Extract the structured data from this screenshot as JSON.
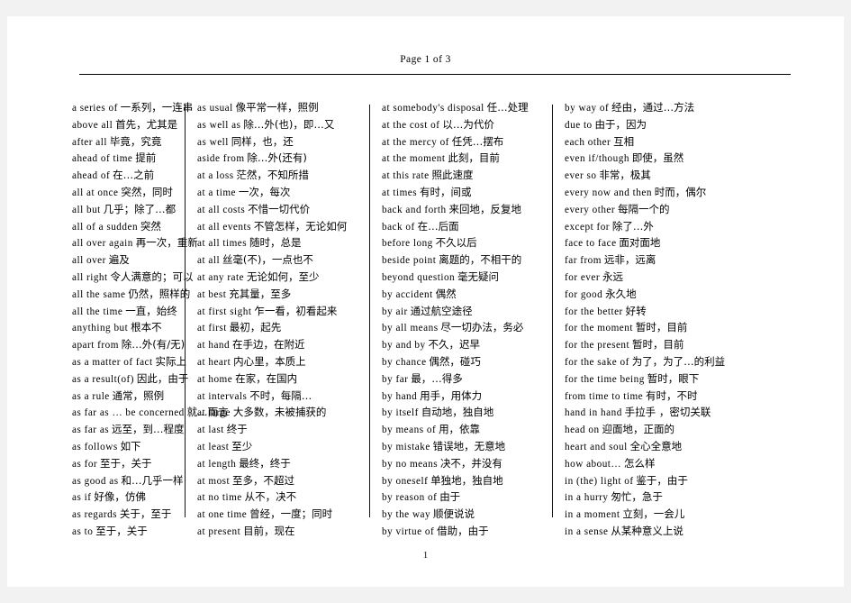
{
  "header": {
    "page_indicator": "Page 1 of 3"
  },
  "footer": {
    "page_number": "1"
  },
  "colors": {
    "page_background": "#ffffff",
    "canvas_background": "#f2f2f2",
    "text": "#000000",
    "rule": "#000000"
  },
  "columns": [
    {
      "entries": [
        {
          "en": "a series of",
          "zh": "一系列，一连串"
        },
        {
          "en": "above all",
          "zh": "首先，尤其是"
        },
        {
          "en": "after all",
          "zh": "毕竟，究竟"
        },
        {
          "en": "ahead of time",
          "zh": "提前"
        },
        {
          "en": "ahead of",
          "zh": "在…之前"
        },
        {
          "en": "all at once",
          "zh": "突然，同时"
        },
        {
          "en": "all but",
          "zh": "几乎；除了…都"
        },
        {
          "en": "all of a sudden",
          "zh": "突然"
        },
        {
          "en": "all over again",
          "zh": "再一次，重新"
        },
        {
          "en": "all over",
          "zh": "遍及"
        },
        {
          "en": "all right",
          "zh": "令人满意的；可以"
        },
        {
          "en": "all the same",
          "zh": "仍然，照样的"
        },
        {
          "en": "all the time",
          "zh": "一直，始终"
        },
        {
          "en": "anything but",
          "zh": "根本不"
        },
        {
          "en": "apart from",
          "zh": "除…外(有/无)"
        },
        {
          "en": "as a matter of fact",
          "zh": "实际上"
        },
        {
          "en": "as a result(of)",
          "zh": "因此，由于"
        },
        {
          "en": "as a rule",
          "zh": "通常，照例"
        },
        {
          "en": "as far as … be concerned",
          "zh": "就…而言"
        },
        {
          "en": "as far as",
          "zh": "远至，到…程度"
        },
        {
          "en": "as follows",
          "zh": "如下"
        },
        {
          "en": "as for",
          "zh": "至于，关于"
        },
        {
          "en": "as good as",
          "zh": "和…几乎一样"
        },
        {
          "en": "as if",
          "zh": "好像，仿佛"
        },
        {
          "en": "as regards",
          "zh": "关于，至于"
        },
        {
          "en": "as to",
          "zh": "至于，关于"
        }
      ]
    },
    {
      "entries": [
        {
          "en": "as usual",
          "zh": "像平常一样，照例"
        },
        {
          "en": "as well as",
          "zh": "除…外(也)，即…又"
        },
        {
          "en": "as well",
          "zh": "同样，也，还"
        },
        {
          "en": "aside from",
          "zh": "除…外(还有)"
        },
        {
          "en": "at a loss",
          "zh": "茫然，不知所措"
        },
        {
          "en": "at a time",
          "zh": "一次，每次"
        },
        {
          "en": "at all costs",
          "zh": "不惜一切代价"
        },
        {
          "en": "at all events",
          "zh": "不管怎样，无论如何"
        },
        {
          "en": "at all times",
          "zh": "随时，总是"
        },
        {
          "en": "at all",
          "zh": "丝毫(不)，一点也不"
        },
        {
          "en": "at any rate",
          "zh": "无论如何，至少"
        },
        {
          "en": "at best",
          "zh": "充其量，至多"
        },
        {
          "en": "at first sight",
          "zh": "乍一看，初看起来"
        },
        {
          "en": "at first",
          "zh": "最初，起先"
        },
        {
          "en": "at hand",
          "zh": "在手边，在附近"
        },
        {
          "en": "at heart",
          "zh": "内心里，本质上"
        },
        {
          "en": "at home",
          "zh": "在家，在国内"
        },
        {
          "en": "at intervals",
          "zh": "不时，每隔…"
        },
        {
          "en": "at large",
          "zh": "大多数，未被捕获的"
        },
        {
          "en": "at last",
          "zh": "终于"
        },
        {
          "en": "at least",
          "zh": "至少"
        },
        {
          "en": "at length",
          "zh": "最终，终于"
        },
        {
          "en": "at most",
          "zh": "至多，不超过"
        },
        {
          "en": "at no time",
          "zh": "从不，决不"
        },
        {
          "en": "at one time",
          "zh": "曾经，一度；同时"
        },
        {
          "en": "at present",
          "zh": "目前，现在"
        }
      ]
    },
    {
      "entries": [
        {
          "en": "at somebody's disposal",
          "zh": "任…处理"
        },
        {
          "en": "at the cost of",
          "zh": "以…为代价"
        },
        {
          "en": "at the mercy of",
          "zh": "任凭…摆布"
        },
        {
          "en": "at the moment",
          "zh": "此刻，目前"
        },
        {
          "en": "at this rate",
          "zh": "照此速度"
        },
        {
          "en": "at times",
          "zh": "有时，间或"
        },
        {
          "en": "back and forth",
          "zh": "来回地，反复地"
        },
        {
          "en": "back of",
          "zh": "在…后面"
        },
        {
          "en": "before long",
          "zh": "不久以后"
        },
        {
          "en": "beside point",
          "zh": "离题的，不相干的"
        },
        {
          "en": "beyond question",
          "zh": "毫无疑问"
        },
        {
          "en": "by accident",
          "zh": "偶然"
        },
        {
          "en": "by air",
          "zh": "通过航空途径"
        },
        {
          "en": "by all means",
          "zh": "尽一切办法，务必"
        },
        {
          "en": "by and by",
          "zh": "不久，迟早"
        },
        {
          "en": "by chance",
          "zh": "偶然，碰巧"
        },
        {
          "en": "by far",
          "zh": "最，…得多"
        },
        {
          "en": "by hand",
          "zh": "用手，用体力"
        },
        {
          "en": "by itself",
          "zh": "自动地，独自地"
        },
        {
          "en": "by means of",
          "zh": "用，依靠"
        },
        {
          "en": "by mistake",
          "zh": "错误地，无意地"
        },
        {
          "en": "by no means",
          "zh": "决不，并没有"
        },
        {
          "en": "by oneself",
          "zh": "单独地，独自地"
        },
        {
          "en": "by reason of",
          "zh": "由于"
        },
        {
          "en": "by the way",
          "zh": "顺便说说"
        },
        {
          "en": "by virtue of",
          "zh": "借助，由于"
        }
      ]
    },
    {
      "entries": [
        {
          "en": "by way of",
          "zh": "经由，通过…方法"
        },
        {
          "en": "due to",
          "zh": "由于，因为"
        },
        {
          "en": "each other",
          "zh": "互相"
        },
        {
          "en": "even if/though",
          "zh": "即使，虽然"
        },
        {
          "en": "ever so",
          "zh": "非常，极其"
        },
        {
          "en": "every now and then",
          "zh": "时而，偶尔"
        },
        {
          "en": "every other",
          "zh": "每隔一个的"
        },
        {
          "en": "except for",
          "zh": "除了…外"
        },
        {
          "en": "face to face",
          "zh": "面对面地"
        },
        {
          "en": "far from",
          "zh": "远非，远离"
        },
        {
          "en": "for ever",
          "zh": "永远"
        },
        {
          "en": "for good",
          "zh": "永久地"
        },
        {
          "en": "for the better",
          "zh": "好转"
        },
        {
          "en": "for the moment",
          "zh": "暂时，目前"
        },
        {
          "en": "for the present",
          "zh": "暂时，目前"
        },
        {
          "en": "for the sake of",
          "zh": "为了，为了…的利益"
        },
        {
          "en": "for the time being",
          "zh": "暂时，眼下"
        },
        {
          "en": "from time to time",
          "zh": "有时，不时"
        },
        {
          "en": "hand in hand",
          "zh": "手拉手 ，密切关联"
        },
        {
          "en": "head on",
          "zh": "迎面地，正面的"
        },
        {
          "en": "heart and soul",
          "zh": "全心全意地"
        },
        {
          "en": "how about…",
          "zh": "怎么样"
        },
        {
          "en": "in (the) light of",
          "zh": "鉴于，由于"
        },
        {
          "en": "in a hurry",
          "zh": "匆忙，急于"
        },
        {
          "en": "in a moment",
          "zh": "立刻，一会儿"
        },
        {
          "en": "in a sense",
          "zh": "从某种意义上说"
        }
      ]
    }
  ]
}
